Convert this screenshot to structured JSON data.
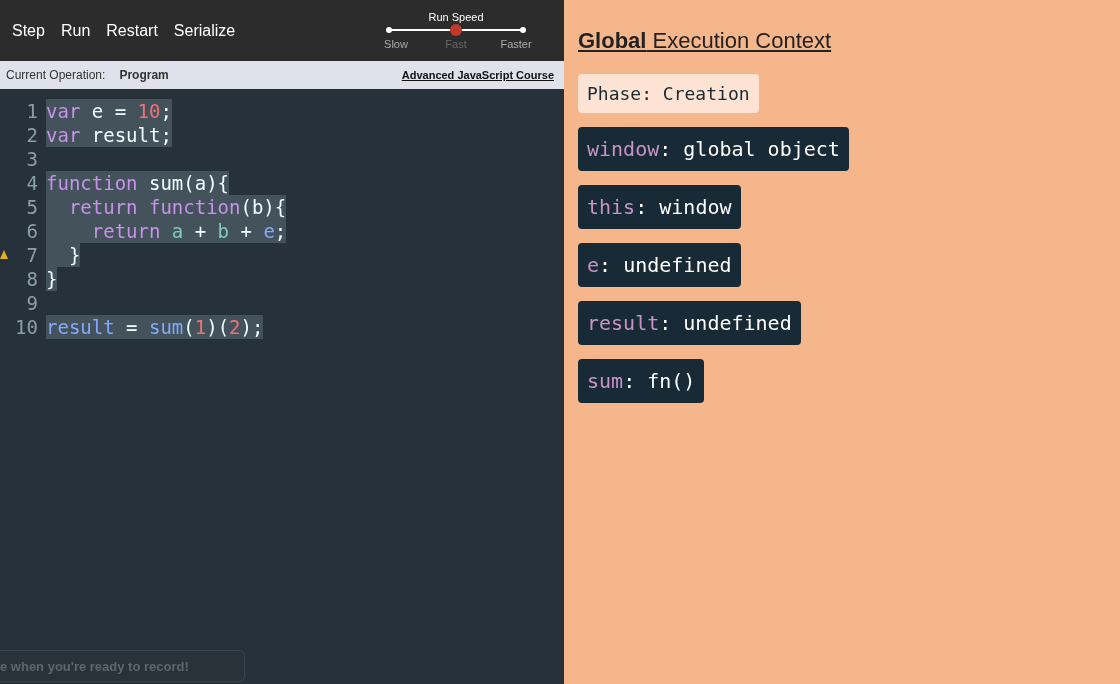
{
  "toolbar": {
    "buttons": [
      "Step",
      "Run",
      "Restart",
      "Serialize"
    ]
  },
  "run_speed": {
    "label": "Run Speed",
    "stops": [
      {
        "label": "Slow",
        "selected": false
      },
      {
        "label": "Fast",
        "selected": true
      },
      {
        "label": "Faster",
        "selected": false
      }
    ]
  },
  "status_bar": {
    "label": "Current Operation:",
    "value": "Program",
    "link": "Advanced JavaScript Course"
  },
  "code": {
    "lines": [
      {
        "number": "1",
        "tokens": [
          {
            "kind": "keyword",
            "text": "var"
          },
          {
            "kind": "plain",
            "text": " e = "
          },
          {
            "kind": "number",
            "text": "10"
          },
          {
            "kind": "plain",
            "text": ";"
          }
        ]
      },
      {
        "number": "2",
        "tokens": [
          {
            "kind": "keyword",
            "text": "var"
          },
          {
            "kind": "plain",
            "text": " result;"
          }
        ]
      },
      {
        "number": "3"
      },
      {
        "number": "4",
        "tokens": [
          {
            "kind": "keyword",
            "text": "function"
          },
          {
            "kind": "plain",
            "text": " sum(a){"
          }
        ]
      },
      {
        "number": "5",
        "tokens": [
          {
            "kind": "keyword",
            "text": "  return"
          },
          {
            "kind": "keyword",
            "text": " function"
          },
          {
            "kind": "plain",
            "text": "(b){"
          }
        ]
      },
      {
        "number": "6",
        "tokens": [
          {
            "kind": "keyword",
            "text": "    return"
          },
          {
            "kind": "param",
            "text": " a"
          },
          {
            "kind": "plain",
            "text": " + "
          },
          {
            "kind": "param",
            "text": "b"
          },
          {
            "kind": "plain",
            "text": " + "
          },
          {
            "kind": "ident",
            "text": "e"
          },
          {
            "kind": "plain",
            "text": ";"
          }
        ]
      },
      {
        "number": "7",
        "warning": true,
        "tokens": [
          {
            "kind": "plain",
            "text": "  }"
          }
        ]
      },
      {
        "number": "8",
        "tokens": [
          {
            "kind": "plain",
            "text": "}"
          }
        ]
      },
      {
        "number": "9"
      },
      {
        "number": "10",
        "tokens": [
          {
            "kind": "ident",
            "text": "result"
          },
          {
            "kind": "plain",
            "text": " = "
          },
          {
            "kind": "ident",
            "text": "sum"
          },
          {
            "kind": "plain",
            "text": "("
          },
          {
            "kind": "number",
            "text": "1"
          },
          {
            "kind": "plain",
            "text": ")("
          },
          {
            "kind": "number",
            "text": "2"
          },
          {
            "kind": "plain",
            "text": ");"
          }
        ]
      }
    ]
  },
  "toast": "e when you're ready to record!",
  "context": {
    "title": "**Global** Execution Context",
    "phase": "Phase: Creation",
    "variables": [
      {
        "name": "window",
        "value": ": global object"
      },
      {
        "name": "this",
        "value": ": window"
      },
      {
        "name": "e",
        "value": ": undefined"
      },
      {
        "name": "result",
        "value": ": undefined"
      },
      {
        "name": "sum",
        "value": ": fn()"
      }
    ]
  }
}
